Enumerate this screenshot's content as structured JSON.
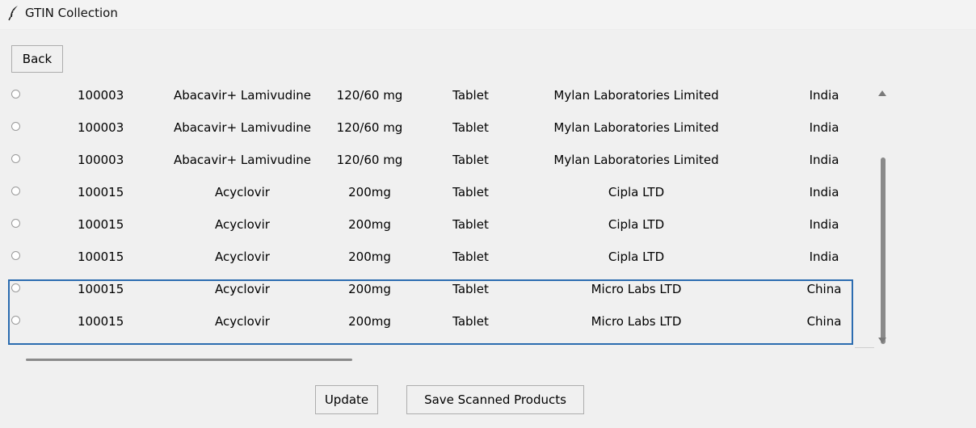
{
  "window": {
    "title": "GTIN Collection",
    "icon": "feather-icon"
  },
  "back_button": {
    "label": "Back"
  },
  "rows": [
    {
      "code": "100003",
      "name": "Abacavir+ Lamivudine",
      "strength": "120/60 mg",
      "form": "Tablet",
      "manufacturer": "Mylan Laboratories Limited",
      "country": "India"
    },
    {
      "code": "100003",
      "name": "Abacavir+ Lamivudine",
      "strength": "120/60 mg",
      "form": "Tablet",
      "manufacturer": "Mylan Laboratories Limited",
      "country": "India"
    },
    {
      "code": "100003",
      "name": "Abacavir+ Lamivudine",
      "strength": "120/60 mg",
      "form": "Tablet",
      "manufacturer": "Mylan Laboratories Limited",
      "country": "India"
    },
    {
      "code": "100015",
      "name": "Acyclovir",
      "strength": "200mg",
      "form": "Tablet",
      "manufacturer": "Cipla LTD",
      "country": "India"
    },
    {
      "code": "100015",
      "name": "Acyclovir",
      "strength": "200mg",
      "form": "Tablet",
      "manufacturer": "Cipla LTD",
      "country": "India"
    },
    {
      "code": "100015",
      "name": "Acyclovir",
      "strength": "200mg",
      "form": "Tablet",
      "manufacturer": "Cipla LTD",
      "country": "India"
    },
    {
      "code": "100015",
      "name": "Acyclovir",
      "strength": "200mg",
      "form": "Tablet",
      "manufacturer": "Micro Labs LTD",
      "country": "China"
    },
    {
      "code": "100015",
      "name": "Acyclovir",
      "strength": "200mg",
      "form": "Tablet",
      "manufacturer": "Micro Labs LTD",
      "country": "China"
    }
  ],
  "buttons": {
    "update": "Update",
    "save": "Save Scanned Products"
  },
  "colors": {
    "background": "#f0f0f0",
    "selection_border": "#2b6cb0",
    "scrollbar": "#8a8a8a"
  }
}
